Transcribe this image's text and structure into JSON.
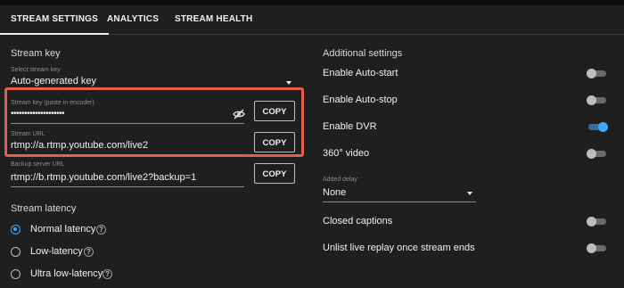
{
  "tabs": [
    {
      "label": "STREAM SETTINGS",
      "active": true
    },
    {
      "label": "ANALYTICS",
      "active": false
    },
    {
      "label": "STREAM HEALTH",
      "active": false
    }
  ],
  "stream_key": {
    "heading": "Stream key",
    "select_label": "Select stream key",
    "select_value": "Auto-generated key",
    "key_label": "Stream key (paste in encoder)",
    "key_value": "••••••••••••••••••••",
    "url_label": "Stream URL",
    "url_value": "rtmp://a.rtmp.youtube.com/live2",
    "backup_label": "Backup server URL",
    "backup_value": "rtmp://b.rtmp.youtube.com/live2?backup=1",
    "copy_label": "COPY"
  },
  "latency": {
    "heading": "Stream latency",
    "options": [
      {
        "label": "Normal latency",
        "selected": true
      },
      {
        "label": "Low-latency",
        "selected": false
      },
      {
        "label": "Ultra low-latency",
        "selected": false
      }
    ],
    "help_glyph": "?"
  },
  "additional": {
    "heading": "Additional settings",
    "toggles": [
      {
        "label": "Enable Auto-start",
        "on": false
      },
      {
        "label": "Enable Auto-stop",
        "on": false
      },
      {
        "label": "Enable DVR",
        "on": true
      },
      {
        "label": "360° video",
        "on": false
      }
    ],
    "delay_label": "Added delay",
    "delay_value": "None",
    "toggles2": [
      {
        "label": "Closed captions",
        "on": false
      },
      {
        "label": "Unlist live replay once stream ends",
        "on": false
      }
    ]
  },
  "colors": {
    "accent": "#3ea6ff",
    "highlight": "#e0604e",
    "background": "#1f1f1f"
  }
}
